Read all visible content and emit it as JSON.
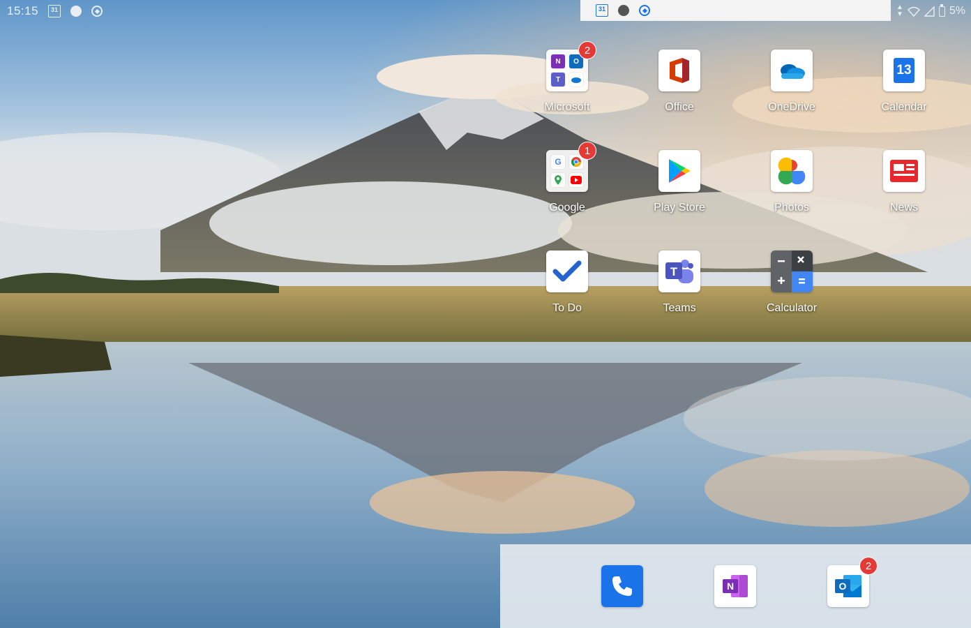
{
  "status_bar": {
    "time": "15:15",
    "calendar_day": "31",
    "battery": "5%"
  },
  "notification_strip": {
    "calendar_day": "31"
  },
  "apps": [
    {
      "label": "Microsoft",
      "badge": "2",
      "icon": "microsoft-folder-icon"
    },
    {
      "label": "Office",
      "badge": "",
      "icon": "office-icon"
    },
    {
      "label": "OneDrive",
      "badge": "",
      "icon": "onedrive-icon"
    },
    {
      "label": "Calendar",
      "badge": "",
      "icon": "calendar-icon",
      "icon_text": "13"
    },
    {
      "label": "Google",
      "badge": "1",
      "icon": "google-folder-icon"
    },
    {
      "label": "Play Store",
      "badge": "",
      "icon": "play-store-icon"
    },
    {
      "label": "Photos",
      "badge": "",
      "icon": "photos-icon"
    },
    {
      "label": "News",
      "badge": "",
      "icon": "news-icon"
    },
    {
      "label": "To Do",
      "badge": "",
      "icon": "todo-icon"
    },
    {
      "label": "Teams",
      "badge": "",
      "icon": "teams-icon"
    },
    {
      "label": "Calculator",
      "badge": "",
      "icon": "calculator-icon"
    }
  ],
  "dock": [
    {
      "icon": "phone-icon",
      "badge": ""
    },
    {
      "icon": "onenote-icon",
      "badge": ""
    },
    {
      "icon": "outlook-icon",
      "badge": "2"
    }
  ],
  "colors": {
    "badge": "#e53935",
    "phone": "#1a73e8",
    "onenote": "#7b2fb5",
    "outlook": "#0f6cbd",
    "todo": "#2564cf"
  }
}
